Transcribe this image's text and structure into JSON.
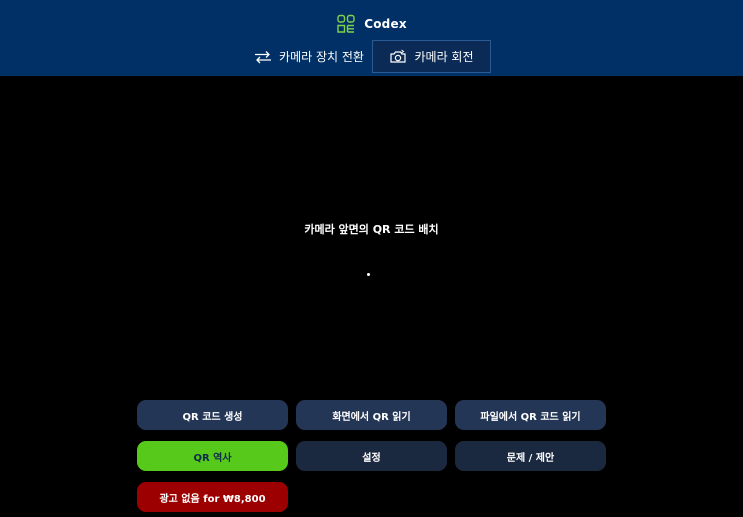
{
  "header": {
    "app_name": "Codex",
    "switch_camera_label": "카메라 장치 전환",
    "rotate_camera_label": "카메라 회전"
  },
  "viewport": {
    "instruction": "카메라 앞면의 QR 코드 배치"
  },
  "actions": {
    "generate_qr": "QR 코드 생성",
    "read_from_screen": "화면에서 QR 읽기",
    "read_from_file": "파일에서 QR 코드 읽기",
    "qr_history": "QR 역사",
    "settings": "설정",
    "issues_suggestions": "문제 / 제안",
    "remove_ads": "광고 없음 for ₩8,800"
  },
  "colors": {
    "header_bg": "#003066",
    "history_green": "#56c91a",
    "remove_ads_red": "#9c0000",
    "button_dark": "#243656"
  }
}
